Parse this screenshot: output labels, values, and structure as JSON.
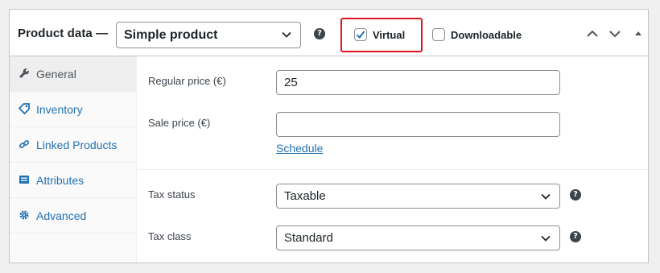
{
  "header": {
    "title": "Product data —",
    "product_type": "Simple product",
    "virtual_label": "Virtual",
    "virtual_checked": true,
    "downloadable_label": "Downloadable",
    "downloadable_checked": false
  },
  "tabs": [
    {
      "label": "General",
      "icon": "wrench-icon",
      "active": true
    },
    {
      "label": "Inventory",
      "icon": "tag-icon",
      "active": false
    },
    {
      "label": "Linked Products",
      "icon": "link-icon",
      "active": false
    },
    {
      "label": "Attributes",
      "icon": "list-icon",
      "active": false
    },
    {
      "label": "Advanced",
      "icon": "gear-icon",
      "active": false
    }
  ],
  "general": {
    "regular_price_label": "Regular price (€)",
    "regular_price_value": "25",
    "sale_price_label": "Sale price (€)",
    "sale_price_value": "",
    "schedule_link": "Schedule",
    "tax_status_label": "Tax status",
    "tax_status_value": "Taxable",
    "tax_class_label": "Tax class",
    "tax_class_value": "Standard"
  },
  "colors": {
    "accent": "#2271b1",
    "highlight": "#e0131e",
    "text": "#1d2327"
  }
}
